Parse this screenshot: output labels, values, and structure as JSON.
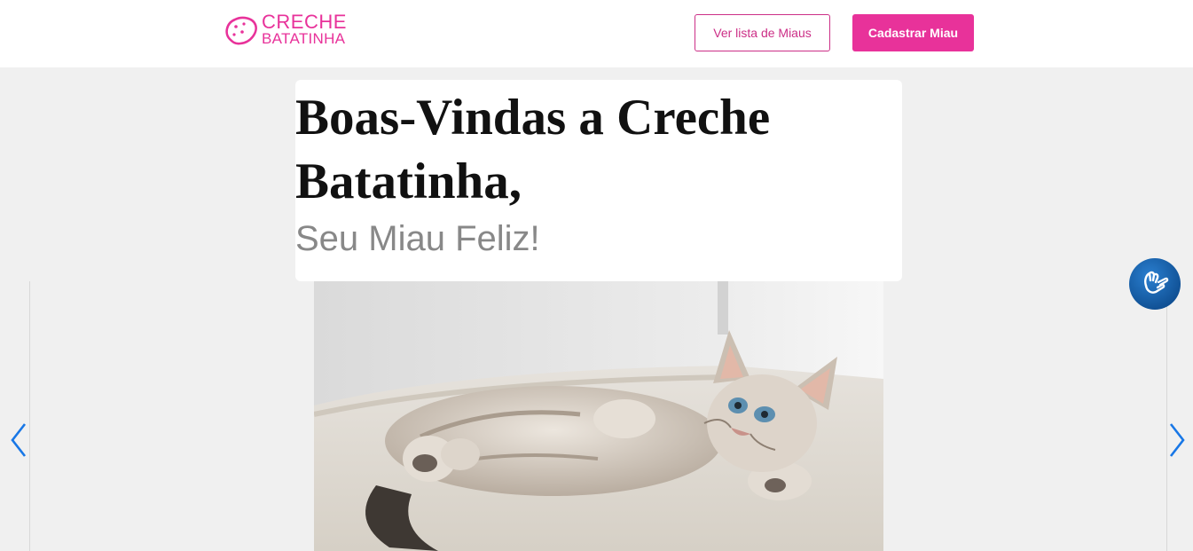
{
  "header": {
    "logo": {
      "line1": "CRECHE",
      "line2": "BATATINHA"
    },
    "nav": {
      "list_label": "Ver lista de Miaus",
      "register_label": "Cadastrar Miau"
    }
  },
  "hero": {
    "title": "Boas-Vindas a Creche Batatinha,",
    "subtitle": "Seu Miau Feliz!"
  },
  "carousel": {
    "image_icon": "cat-photo",
    "prev_icon": "chevron-left-icon",
    "next_icon": "chevron-right-icon"
  },
  "accessibility": {
    "icon": "sign-language-icon"
  },
  "colors": {
    "brand": "#e8329a",
    "brand_dark": "#cc2f87",
    "accent_arrow": "#1877e6",
    "a11y_button": "#07407f"
  }
}
